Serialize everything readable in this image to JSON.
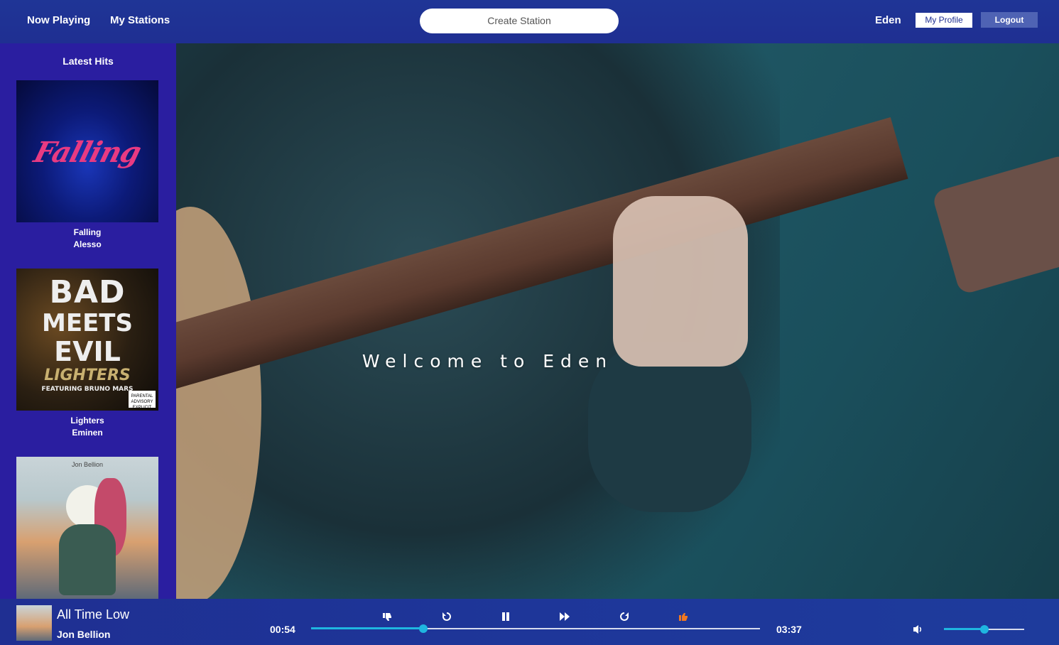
{
  "nav": {
    "now_playing": "Now Playing",
    "my_stations": "My Stations",
    "create_station": "Create Station",
    "username": "Eden",
    "my_profile": "My Profile",
    "logout": "Logout"
  },
  "sidebar": {
    "title": "Latest Hits",
    "items": [
      {
        "title": "Falling",
        "artist": "Alesso",
        "cover_text": "Falling"
      },
      {
        "title": "Lighters",
        "artist": "Eminen",
        "cover_text": [
          "BAD",
          "MEETS",
          "EVIL",
          "LIGHTERS",
          "FEATURING BRUNO MARS"
        ],
        "advisory": "PARENTAL ADVISORY EXPLICIT CONTENT"
      },
      {
        "title": "",
        "artist": "",
        "cover_text": "Jon Bellion"
      }
    ]
  },
  "hero": {
    "welcome": "Welcome to Eden"
  },
  "player": {
    "title": "All Time Low",
    "artist": "Jon Bellion",
    "current_time": "00:54",
    "duration": "03:37",
    "progress_fraction": 0.25,
    "volume_fraction": 0.5,
    "accent_color": "#1fb6e0",
    "like_color": "#f07820",
    "controls": [
      "thumbs-down-icon",
      "replay-icon",
      "pause-icon",
      "fast-forward-icon",
      "redo-icon",
      "thumbs-up-icon"
    ]
  }
}
